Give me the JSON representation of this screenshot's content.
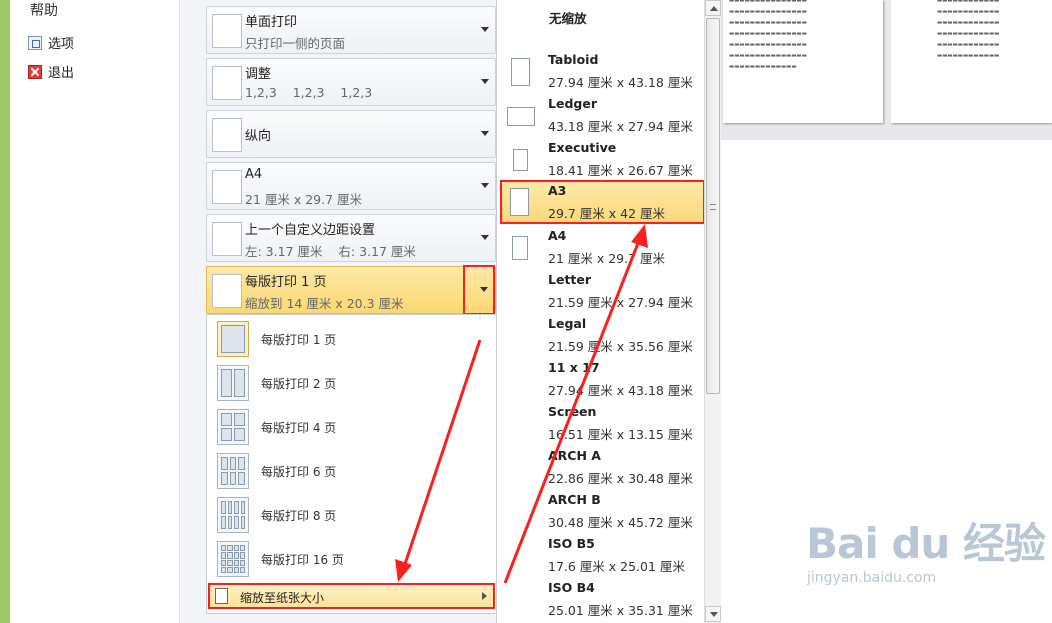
{
  "sidebar": {
    "title": "帮助",
    "items": [
      {
        "label": "选项",
        "icon": "options-icon"
      },
      {
        "label": "退出",
        "icon": "exit-icon"
      }
    ]
  },
  "settings": {
    "sides": {
      "main": "单面打印",
      "sub": "只打印一侧的页面"
    },
    "collate": {
      "main": "调整",
      "sub": "1,2,3    1,2,3    1,2,3"
    },
    "orientation": {
      "main": "纵向"
    },
    "paper": {
      "main": "A4",
      "sub": "21 厘米 x 29.7 厘米"
    },
    "margins": {
      "main": "上一个自定义边距设置",
      "sub": "左: 3.17 厘米    右: 3.17 厘米"
    },
    "pages_per_sheet": {
      "main": "每版打印 1 页",
      "sub": "缩放到 14 厘米 x 20.3 厘米"
    }
  },
  "pages_per_sheet_menu": {
    "items": [
      {
        "label": "每版打印 1 页",
        "icon": "one-page-icon"
      },
      {
        "label": "每版打印 2 页",
        "icon": "two-pages-icon"
      },
      {
        "label": "每版打印 4 页",
        "icon": "four-pages-icon"
      },
      {
        "label": "每版打印 6 页",
        "icon": "six-pages-icon"
      },
      {
        "label": "每版打印 8 页",
        "icon": "eight-pages-icon"
      },
      {
        "label": "每版打印 16 页",
        "icon": "sixteen-pages-icon"
      }
    ],
    "fit_label": "缩放至纸张大小"
  },
  "paper_size_menu": {
    "no_scale": "无缩放",
    "items": [
      {
        "name": "Tabloid",
        "dims": "27.94 厘米 x 43.18 厘米"
      },
      {
        "name": "Ledger",
        "dims": "43.18 厘米 x 27.94 厘米"
      },
      {
        "name": "Executive",
        "dims": "18.41 厘米 x 26.67 厘米"
      },
      {
        "name": "A3",
        "dims": "29.7 厘米 x 42 厘米"
      },
      {
        "name": "A4",
        "dims": "21 厘米 x 29.7 厘米"
      },
      {
        "name": "Letter",
        "dims": "21.59 厘米 x 27.94 厘米"
      },
      {
        "name": "Legal",
        "dims": "21.59 厘米 x 35.56 厘米"
      },
      {
        "name": "11 x 17",
        "dims": "27.94 厘米 x 43.18 厘米"
      },
      {
        "name": "Screen",
        "dims": "16.51 厘米 x 13.15 厘米"
      },
      {
        "name": "ARCH A",
        "dims": "22.86 厘米 x 30.48 厘米"
      },
      {
        "name": "ARCH B",
        "dims": "30.48 厘米 x 45.72 厘米"
      },
      {
        "name": "ISO B5",
        "dims": "17.6 厘米 x 25.01 厘米"
      },
      {
        "name": "ISO B4",
        "dims": "25.01 厘米 x 35.31 厘米"
      }
    ]
  },
  "watermark": {
    "logo": "Bai du 经验",
    "url": "jingyan.baidu.com"
  },
  "colors": {
    "highlight": "#fbd97b",
    "annotation": "#ff1e1e",
    "sidebar_accent": "#9cc86a"
  }
}
